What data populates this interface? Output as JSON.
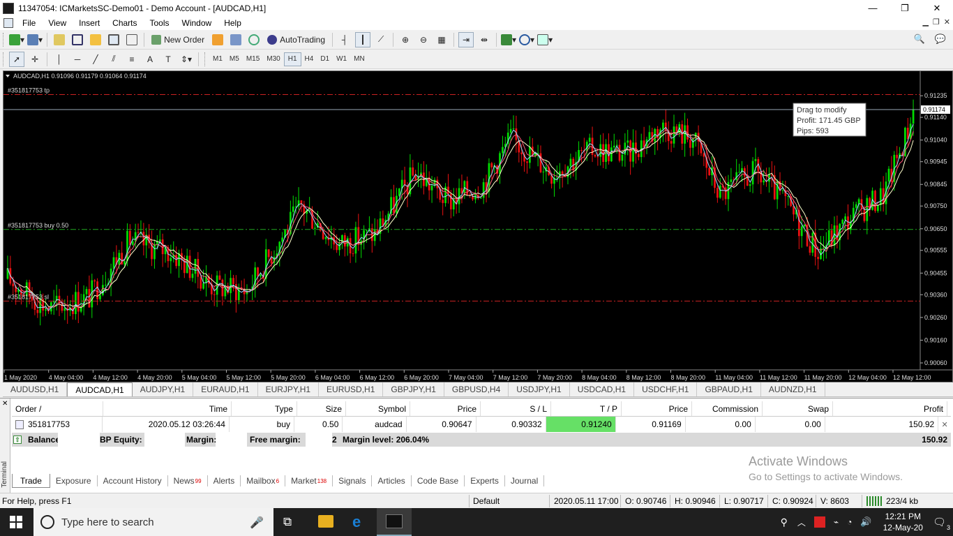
{
  "window": {
    "title": "11347054: ICMarketsSC-Demo01 - Demo Account - [AUDCAD,H1]",
    "minimize": "—",
    "maximize": "❐",
    "close": "✕"
  },
  "menu": [
    "File",
    "View",
    "Insert",
    "Charts",
    "Tools",
    "Window",
    "Help"
  ],
  "toolbar": {
    "new_order": "New Order",
    "autotrading": "AutoTrading"
  },
  "timeframes": [
    "M1",
    "M5",
    "M15",
    "M30",
    "H1",
    "H4",
    "D1",
    "W1",
    "MN"
  ],
  "active_timeframe": "H1",
  "chart": {
    "header": "AUDCAD,H1  0.91096 0.91179 0.91064 0.91174",
    "tp_label": "#351817753 tp",
    "buy_label": "#351817753 buy 0.50",
    "sl_label": "#351817753 sl",
    "current_price": "0.91174",
    "tooltip": {
      "line1": "Drag to modify",
      "line2": "Profit: 171.45 GBP",
      "line3": "Pips: 593"
    },
    "colors": {
      "bg": "#000000",
      "bull": "#00dd00",
      "bear": "#ee1111",
      "tp": "#cc2222",
      "buy": "#22aa22",
      "ma_fast": "#9fd6ff",
      "ma_mid": "#ff5b7a",
      "ma_slow": "#ffffcc"
    }
  },
  "chart_data": {
    "type": "candlestick",
    "symbol": "AUDCAD",
    "timeframe": "H1",
    "ylim": [
      0.9006,
      0.913
    ],
    "price_ticks": [
      "0.91235",
      "0.91140",
      "0.91040",
      "0.90945",
      "0.90845",
      "0.90750",
      "0.90650",
      "0.90555",
      "0.90455",
      "0.90360",
      "0.90260",
      "0.90160",
      "0.90060"
    ],
    "time_ticks": [
      "1 May 2020",
      "4 May 04:00",
      "4 May 12:00",
      "4 May 20:00",
      "5 May 04:00",
      "5 May 12:00",
      "5 May 20:00",
      "6 May 04:00",
      "6 May 12:00",
      "6 May 20:00",
      "7 May 04:00",
      "7 May 12:00",
      "7 May 20:00",
      "8 May 04:00",
      "8 May 12:00",
      "8 May 20:00",
      "11 May 04:00",
      "11 May 12:00",
      "11 May 20:00",
      "12 May 04:00",
      "12 May 12:00"
    ],
    "levels": {
      "tp": 0.9124,
      "entry": 0.90647,
      "sl": 0.90332,
      "bid": 0.91174
    },
    "trend": [
      [
        0,
        0.9043
      ],
      [
        15,
        0.903
      ],
      [
        30,
        0.9035
      ],
      [
        45,
        0.906
      ],
      [
        60,
        0.9055
      ],
      [
        75,
        0.904
      ],
      [
        88,
        0.9038
      ],
      [
        100,
        0.906
      ],
      [
        108,
        0.9075
      ],
      [
        122,
        0.9058
      ],
      [
        135,
        0.9063
      ],
      [
        150,
        0.909
      ],
      [
        162,
        0.9077
      ],
      [
        175,
        0.9085
      ],
      [
        185,
        0.9105
      ],
      [
        200,
        0.909
      ],
      [
        215,
        0.91
      ],
      [
        228,
        0.9098
      ],
      [
        240,
        0.911
      ],
      [
        252,
        0.9105
      ],
      [
        262,
        0.908
      ],
      [
        275,
        0.909
      ],
      [
        285,
        0.9078
      ],
      [
        298,
        0.9055
      ],
      [
        310,
        0.907
      ],
      [
        322,
        0.908
      ],
      [
        333,
        0.9115
      ]
    ]
  },
  "chart_tabs": [
    "AUDUSD,H1",
    "AUDCAD,H1",
    "AUDJPY,H1",
    "EURAUD,H1",
    "EURJPY,H1",
    "EURUSD,H1",
    "GBPJPY,H1",
    "GBPUSD,H4",
    "USDJPY,H1",
    "USDCAD,H1",
    "USDCHF,H1",
    "GBPAUD,H1",
    "AUDNZD,H1"
  ],
  "active_chart_tab": "AUDCAD,H1",
  "terminal": {
    "side_label": "Terminal",
    "columns": [
      "Order  /",
      "Time",
      "Type",
      "Size",
      "Symbol",
      "Price",
      "S / L",
      "T / P",
      "Price",
      "Commission",
      "Swap",
      "Profit"
    ],
    "orders": [
      {
        "order": "351817753",
        "time": "2020.05.12 03:26:44",
        "type": "buy",
        "size": "0.50",
        "symbol": "audcad",
        "price": "0.90647",
        "sl": "0.90332",
        "tp": "0.91240",
        "cur_price": "0.91169",
        "commission": "0.00",
        "swap": "0.00",
        "profit": "150.92"
      }
    ],
    "balance_row": {
      "balance": "Balance:",
      "gbp_frag": "BP",
      "equity": "Equity:",
      "margin": "Margin:",
      "free_margin": "Free margin:",
      "frag2": "2",
      "margin_level": "Margin level: 206.04%",
      "total": "150.92"
    },
    "tabs": [
      {
        "label": "Trade",
        "badge": ""
      },
      {
        "label": "Exposure",
        "badge": ""
      },
      {
        "label": "Account History",
        "badge": ""
      },
      {
        "label": "News",
        "badge": "99"
      },
      {
        "label": "Alerts",
        "badge": ""
      },
      {
        "label": "Mailbox",
        "badge": "6"
      },
      {
        "label": "Market",
        "badge": "138"
      },
      {
        "label": "Signals",
        "badge": ""
      },
      {
        "label": "Articles",
        "badge": ""
      },
      {
        "label": "Code Base",
        "badge": ""
      },
      {
        "label": "Experts",
        "badge": ""
      },
      {
        "label": "Journal",
        "badge": ""
      }
    ]
  },
  "watermark": {
    "line1": "Activate Windows",
    "line2": "Go to Settings to activate Windows."
  },
  "status": {
    "help": "For Help, press F1",
    "profile": "Default",
    "datetime": "2020.05.11 17:00",
    "open": "O: 0.90746",
    "high": "H: 0.90946",
    "low": "L: 0.90717",
    "close": "C: 0.90924",
    "volume": "V: 8603",
    "traffic": "223/4 kb"
  },
  "taskbar": {
    "search_placeholder": "Type here to search",
    "time": "12:21 PM",
    "date": "12-May-20",
    "notifications": "3"
  }
}
